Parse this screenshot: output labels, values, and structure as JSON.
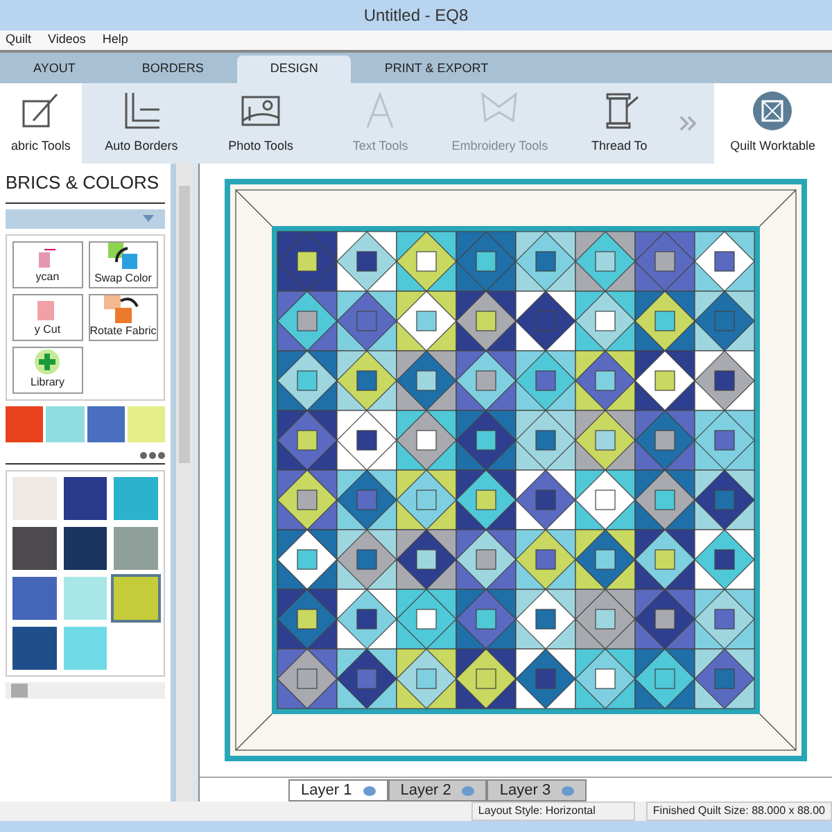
{
  "window": {
    "title": "Untitled - EQ8"
  },
  "menu": [
    "Quilt",
    "Videos",
    "Help"
  ],
  "tabs": [
    {
      "label": "AYOUT",
      "selected": false
    },
    {
      "label": "BORDERS",
      "selected": false
    },
    {
      "label": "DESIGN",
      "selected": true
    },
    {
      "label": "PRINT & EXPORT",
      "selected": false
    }
  ],
  "ribbon": [
    {
      "label": "abric Tools",
      "kind": "fabric",
      "selected": true,
      "disabled": false
    },
    {
      "label": "Auto Borders",
      "kind": "borders",
      "selected": false,
      "disabled": false
    },
    {
      "label": "Photo Tools",
      "kind": "photo",
      "selected": false,
      "disabled": false
    },
    {
      "label": "Text Tools",
      "kind": "text",
      "selected": false,
      "disabled": true
    },
    {
      "label": "Embroidery Tools",
      "kind": "embroidery",
      "selected": false,
      "disabled": true
    },
    {
      "label": "Thread To",
      "kind": "thread",
      "selected": false,
      "disabled": false
    }
  ],
  "worktable": {
    "label": "Quilt Worktable"
  },
  "panel": {
    "title": "BRICS & COLORS",
    "tools": [
      {
        "label": "ycan",
        "kind": "spraycan"
      },
      {
        "label": "Swap Color",
        "kind": "swap"
      },
      {
        "label": "y Cut",
        "kind": "cut"
      },
      {
        "label": "Rotate Fabric",
        "kind": "rotate"
      },
      {
        "label": "Library",
        "kind": "library"
      }
    ],
    "strip": [
      {
        "color": "#e8431c"
      },
      {
        "color": "#8fdde0"
      },
      {
        "color": "#4a6fc0"
      },
      {
        "color": "#e4ee8a"
      }
    ],
    "swatches": [
      {
        "color": "#efe9e6",
        "selected": false
      },
      {
        "color": "#2a3a8c",
        "selected": false
      },
      {
        "color": "#2bb2cc",
        "selected": false
      },
      {
        "color": "#4c4a4e",
        "selected": false
      },
      {
        "color": "#1a3560",
        "selected": false
      },
      {
        "color": "#8fa09a",
        "selected": false
      },
      {
        "color": "#4466b8",
        "selected": false
      },
      {
        "color": "#a8e6e8",
        "selected": false
      },
      {
        "color": "#c4cc3a",
        "selected": true
      },
      {
        "color": "#1f4f8a",
        "selected": false
      },
      {
        "color": "#6fdbe6",
        "selected": false
      }
    ]
  },
  "layers": [
    {
      "label": "Layer 1",
      "selected": true
    },
    {
      "label": "Layer 2",
      "selected": false
    },
    {
      "label": "Layer 3",
      "selected": false
    }
  ],
  "status_bar": [
    "Layout Style: Horizontal",
    "Finished Quilt Size: 88.000 x 88.00"
  ]
}
